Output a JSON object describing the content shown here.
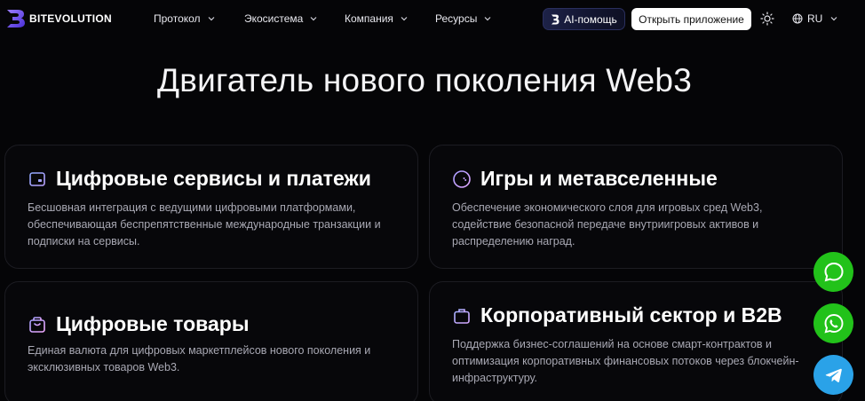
{
  "brand": {
    "name": "BITEVOLUTION",
    "accent": "#6c4cf1"
  },
  "nav": [
    {
      "label": "Протокол"
    },
    {
      "label": "Экосистема"
    },
    {
      "label": "Компания"
    },
    {
      "label": "Ресурсы"
    }
  ],
  "header": {
    "ai_label": "AI-помощь",
    "open_app_label": "Открыть приложение",
    "language": "RU",
    "theme_icon": "sun-icon",
    "language_icon": "globe-icon"
  },
  "main": {
    "title": "Двигатель нового поколения Web3",
    "cards": [
      {
        "icon": "wallet-icon",
        "title": "Цифровые сервисы и платежи",
        "lines": [
          "Бесшовная интеграция с ведущими цифровыми платформами,",
          "обеспечивающая беспрепятственные международные транзакции и",
          "подписки на сервисы."
        ]
      },
      {
        "icon": "gamepad-icon",
        "title": "Игры и метавселенные",
        "lines": [
          "Обеспечение экономического слоя для игровых сред Web3,",
          "содействие безопасной передаче внутриигровых активов и",
          "распределению наград."
        ]
      },
      {
        "icon": "shopping-bag-icon",
        "title": "Цифровые товары",
        "lines": [
          "Единая валюта для цифровых маркетплейсов нового поколения и",
          "эксклюзивных товаров Web3."
        ]
      },
      {
        "icon": "briefcase-icon",
        "title": "Корпоративный сектор и B2B",
        "lines": [
          "Поддержка бизнес-соглашений на основе смарт-контрактов и",
          "оптимизация корпоративных финансовых потоков через блокчейн-",
          "инфраструктуру."
        ]
      }
    ]
  },
  "floating": {
    "chat_color": "#22c21a",
    "whatsapp_color": "#22c21a",
    "telegram_color": "#2aa2e8"
  }
}
